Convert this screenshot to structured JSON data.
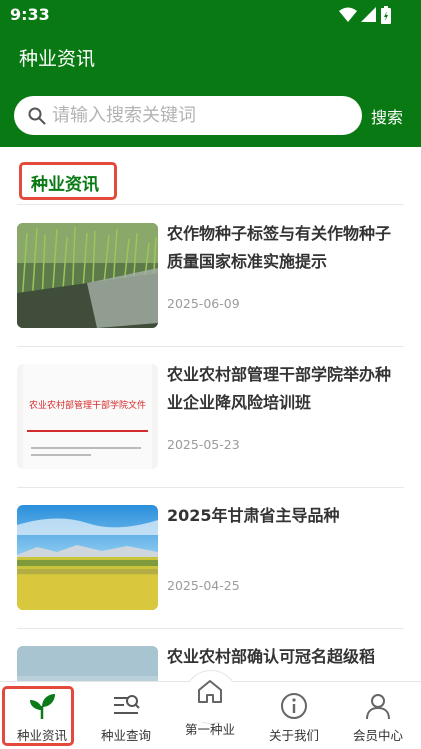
{
  "status_bar": {
    "time": "9:33"
  },
  "header": {
    "title": "种业资讯"
  },
  "search": {
    "placeholder": "请输入搜索关键词",
    "value": "",
    "button_label": "搜索"
  },
  "section": {
    "title": "种业资讯"
  },
  "news": [
    {
      "title": "农作物种子标签与有关作物种子质量国家标准实施提示",
      "date": "2025-06-09",
      "thumb_icon": "seedling-tray-photo"
    },
    {
      "title": "农业农村部管理干部学院举办种业企业降风险培训班",
      "date": "2025-05-23",
      "thumb_icon": "document-photo",
      "thumb_text": "农业农村部管理干部学院文件"
    },
    {
      "title": "2025年甘肃省主导品种",
      "date": "2025-04-25",
      "thumb_icon": "field-landscape-photo"
    },
    {
      "title": "农业农村部确认可冠名超级稻",
      "date": "",
      "thumb_icon": "landscape-photo"
    }
  ],
  "tabs": [
    {
      "label": "种业资讯",
      "icon": "sprout-icon",
      "active": true
    },
    {
      "label": "种业查询",
      "icon": "search-list-icon",
      "active": false
    },
    {
      "label": "第一种业",
      "icon": "home-icon",
      "active": false
    },
    {
      "label": "关于我们",
      "icon": "info-icon",
      "active": false
    },
    {
      "label": "会员中心",
      "icon": "user-icon",
      "active": false
    }
  ],
  "colors": {
    "brand_green": "#097a13",
    "highlight_red": "#e34a3b",
    "date_gray": "#9b9b9b"
  }
}
